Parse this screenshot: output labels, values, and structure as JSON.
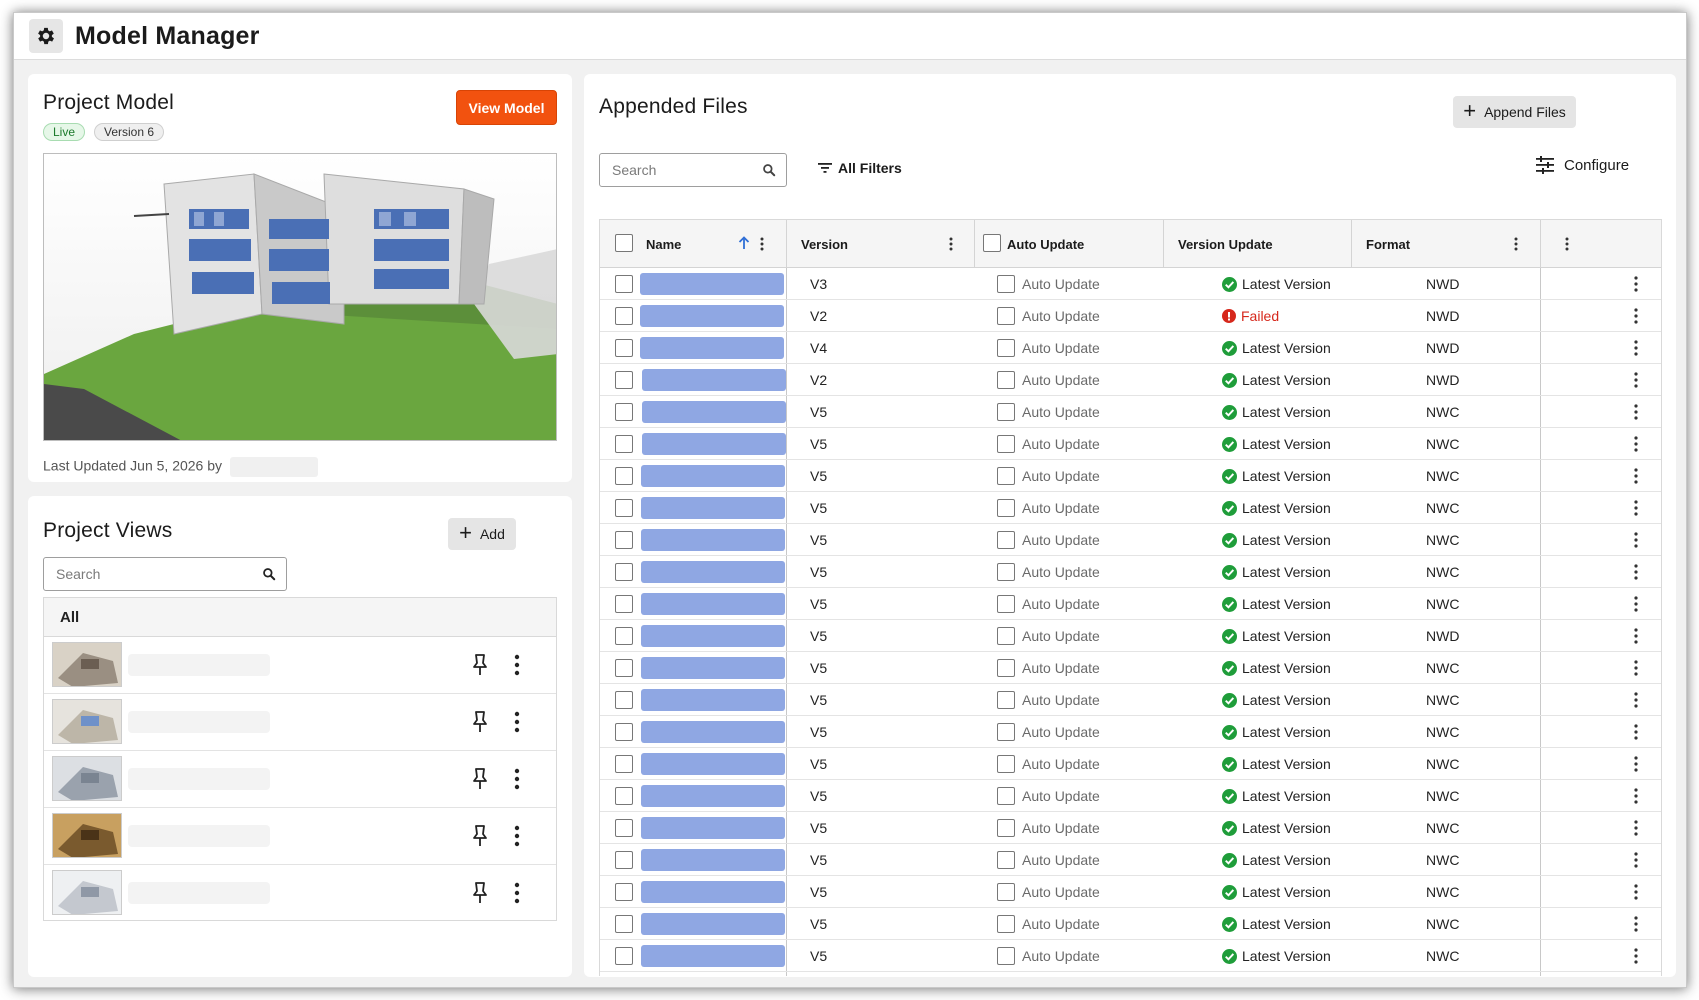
{
  "app": {
    "title": "Model Manager",
    "icon": "gear-icon"
  },
  "project_model": {
    "title": "Project Model",
    "view_button": "View Model",
    "badges": {
      "live": "Live",
      "version": "Version 6"
    },
    "last_updated": "Last Updated Jun 5, 2026 by"
  },
  "project_views": {
    "title": "Project Views",
    "add_button": "Add",
    "search_placeholder": "Search",
    "list_header": "All",
    "items_count_shown": 5
  },
  "appended_files": {
    "title": "Appended Files",
    "append_button": "Append Files",
    "search_placeholder": "Search",
    "filters_label": "All Filters",
    "configure_label": "Configure",
    "columns": [
      "Name",
      "Version",
      "Auto Update",
      "Version Update",
      "Format"
    ],
    "auto_update_label": "Auto Update",
    "rows": [
      {
        "version": "V3",
        "status": "Latest Version",
        "format": "NWD"
      },
      {
        "version": "V2",
        "status": "Failed",
        "format": "NWD"
      },
      {
        "version": "V4",
        "status": "Latest Version",
        "format": "NWD"
      },
      {
        "version": "V2",
        "status": "Latest Version",
        "format": "NWD"
      },
      {
        "version": "V5",
        "status": "Latest Version",
        "format": "NWC"
      },
      {
        "version": "V5",
        "status": "Latest Version",
        "format": "NWC"
      },
      {
        "version": "V5",
        "status": "Latest Version",
        "format": "NWC"
      },
      {
        "version": "V5",
        "status": "Latest Version",
        "format": "NWC"
      },
      {
        "version": "V5",
        "status": "Latest Version",
        "format": "NWC"
      },
      {
        "version": "V5",
        "status": "Latest Version",
        "format": "NWC"
      },
      {
        "version": "V5",
        "status": "Latest Version",
        "format": "NWC"
      },
      {
        "version": "V5",
        "status": "Latest Version",
        "format": "NWD"
      },
      {
        "version": "V5",
        "status": "Latest Version",
        "format": "NWC"
      },
      {
        "version": "V5",
        "status": "Latest Version",
        "format": "NWC"
      },
      {
        "version": "V5",
        "status": "Latest Version",
        "format": "NWC"
      },
      {
        "version": "V5",
        "status": "Latest Version",
        "format": "NWC"
      },
      {
        "version": "V5",
        "status": "Latest Version",
        "format": "NWC"
      },
      {
        "version": "V5",
        "status": "Latest Version",
        "format": "NWC"
      },
      {
        "version": "V5",
        "status": "Latest Version",
        "format": "NWC"
      },
      {
        "version": "V5",
        "status": "Latest Version",
        "format": "NWC"
      },
      {
        "version": "V5",
        "status": "Latest Version",
        "format": "NWC"
      },
      {
        "version": "V5",
        "status": "Latest Version",
        "format": "NWC"
      }
    ]
  },
  "colors": {
    "accent_orange": "#f2520f",
    "success_green": "#1f9d3a",
    "error_red": "#d6281c",
    "name_placeholder_blue": "#8fa7e3",
    "sort_arrow_blue": "#2f6fd6"
  }
}
